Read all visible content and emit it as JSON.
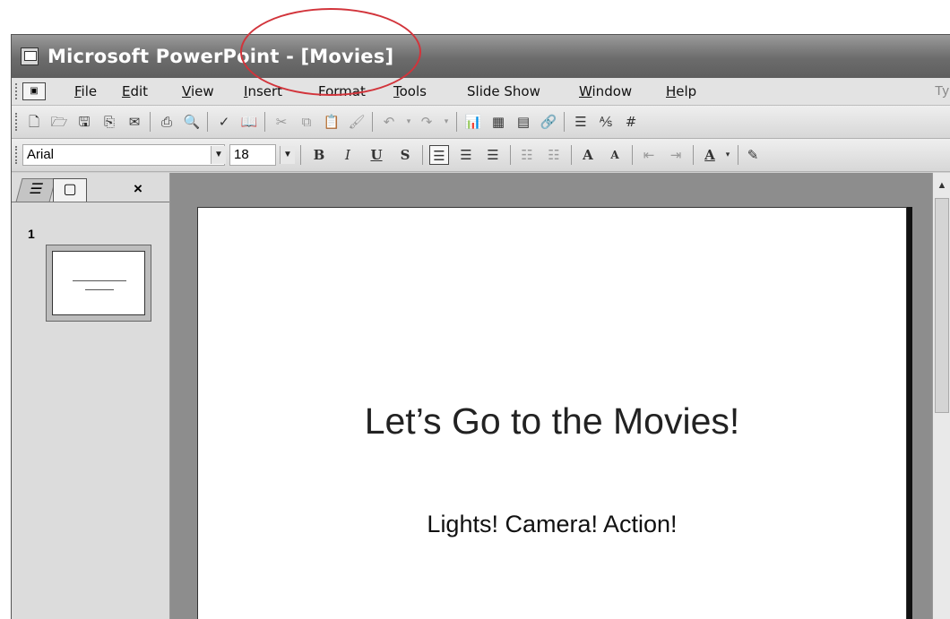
{
  "window": {
    "title": "Microsoft PowerPoint - [Movies]"
  },
  "menu": {
    "items": [
      {
        "label": "File",
        "access": "F",
        "rest": "ile"
      },
      {
        "label": "Edit",
        "access": "E",
        "rest": "dit"
      },
      {
        "label": "View",
        "access": "V",
        "rest": "iew"
      },
      {
        "label": "Insert",
        "access": "I",
        "rest": "nsert"
      },
      {
        "label": "Format",
        "access": "",
        "rest": "Format"
      },
      {
        "label": "Tools",
        "access": "T",
        "rest": "ools"
      },
      {
        "label": "Slide Show",
        "access": "",
        "rest": "Slide Show"
      },
      {
        "label": "Window",
        "access": "W",
        "rest": "indow"
      },
      {
        "label": "Help",
        "access": "H",
        "rest": "elp"
      }
    ],
    "type_question_partial": "Ty"
  },
  "formatting": {
    "font_name": "Arial",
    "font_size": "18",
    "bold": "B",
    "italic": "I",
    "underline": "U",
    "shadow": "S",
    "font_color_label": "A"
  },
  "slides_pane": {
    "slide_number": "1",
    "close_glyph": "×"
  },
  "slide": {
    "title": "Let’s Go to the Movies!",
    "subtitle": "Lights! Camera! Action!"
  },
  "colors": {
    "annotation": "#d2343b",
    "title_bar": "#6c6c6c"
  }
}
